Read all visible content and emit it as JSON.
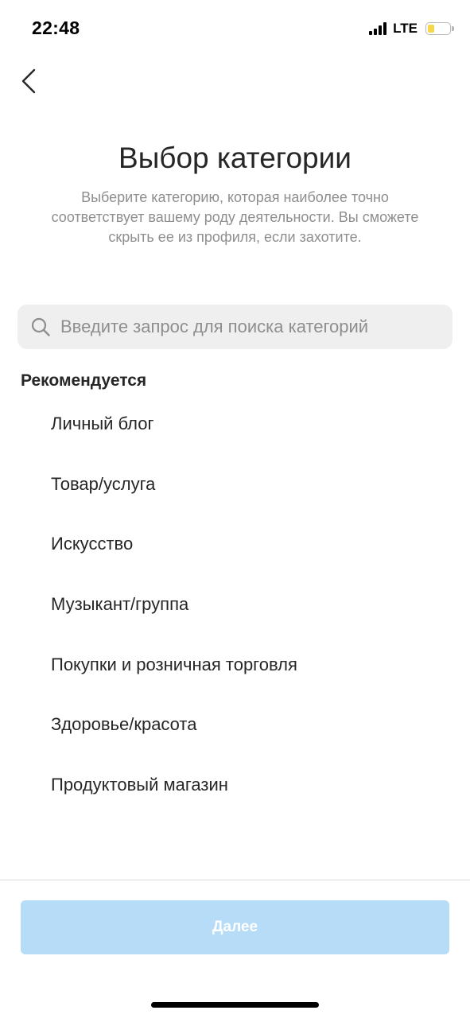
{
  "status_bar": {
    "time": "22:48",
    "network": "LTE",
    "battery_level": 0.3,
    "battery_color": "#f6d74b"
  },
  "nav": {
    "back_icon": "chevron-left-icon"
  },
  "header": {
    "title": "Выбор категории",
    "subtitle": "Выберите категорию, которая наиболее точно соответствует вашему роду деятельности. Вы сможете скрыть ее из профиля, если захотите."
  },
  "search": {
    "icon": "search-icon",
    "value": "",
    "placeholder": "Введите запрос для поиска категорий"
  },
  "recommended": {
    "heading": "Рекомендуется",
    "items": [
      "Личный блог",
      "Товар/услуга",
      "Искусство",
      "Музыкант/группа",
      "Покупки и розничная торговля",
      "Здоровье/красота",
      "Продуктовый магазин"
    ]
  },
  "footer": {
    "next_label": "Далее",
    "next_disabled": true,
    "button_color": "#b7dcf7"
  }
}
